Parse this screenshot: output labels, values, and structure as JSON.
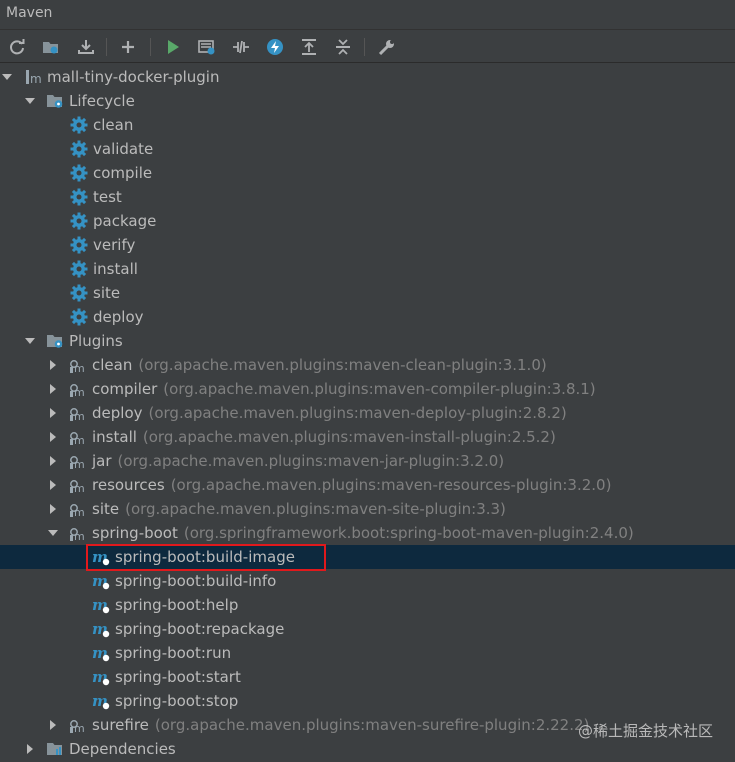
{
  "window": {
    "title": "Maven"
  },
  "toolbar": {
    "buttons": [
      {
        "name": "reload-icon"
      },
      {
        "name": "folder-generate-icon"
      },
      {
        "name": "download-icon"
      },
      {
        "name": "add-icon"
      },
      {
        "name": "run-icon"
      },
      {
        "name": "execute-goal-icon"
      },
      {
        "name": "toggle-offline-icon"
      },
      {
        "name": "skip-tests-icon"
      },
      {
        "name": "show-dependencies-icon"
      },
      {
        "name": "collapse-all-icon"
      },
      {
        "name": "settings-wrench-icon"
      }
    ]
  },
  "tree": {
    "project": "mall-tiny-docker-plugin",
    "lifecycle": {
      "label": "Lifecycle",
      "phases": [
        "clean",
        "validate",
        "compile",
        "test",
        "package",
        "verify",
        "install",
        "site",
        "deploy"
      ]
    },
    "plugins": {
      "label": "Plugins",
      "items": [
        {
          "name": "clean",
          "coord": "(org.apache.maven.plugins:maven-clean-plugin:3.1.0)"
        },
        {
          "name": "compiler",
          "coord": "(org.apache.maven.plugins:maven-compiler-plugin:3.8.1)"
        },
        {
          "name": "deploy",
          "coord": "(org.apache.maven.plugins:maven-deploy-plugin:2.8.2)"
        },
        {
          "name": "install",
          "coord": "(org.apache.maven.plugins:maven-install-plugin:2.5.2)"
        },
        {
          "name": "jar",
          "coord": "(org.apache.maven.plugins:maven-jar-plugin:3.2.0)"
        },
        {
          "name": "resources",
          "coord": "(org.apache.maven.plugins:maven-resources-plugin:3.2.0)"
        },
        {
          "name": "site",
          "coord": "(org.apache.maven.plugins:maven-site-plugin:3.3)"
        },
        {
          "name": "spring-boot",
          "coord": "(org.springframework.boot:spring-boot-maven-plugin:2.4.0)"
        }
      ],
      "spring_boot_goals": [
        "spring-boot:build-image",
        "spring-boot:build-info",
        "spring-boot:help",
        "spring-boot:repackage",
        "spring-boot:run",
        "spring-boot:start",
        "spring-boot:stop"
      ],
      "surefire": {
        "name": "surefire",
        "coord": "(org.apache.maven.plugins:maven-surefire-plugin:2.22.2)"
      }
    },
    "dependencies": {
      "label": "Dependencies"
    },
    "selected_goal": "spring-boot:build-image"
  },
  "watermark": "@稀土掘金技术社区",
  "colors": {
    "background": "#3c3f41",
    "selection": "#0d293e",
    "highlight_border": "#e0191c",
    "gear": "#3592c4"
  }
}
